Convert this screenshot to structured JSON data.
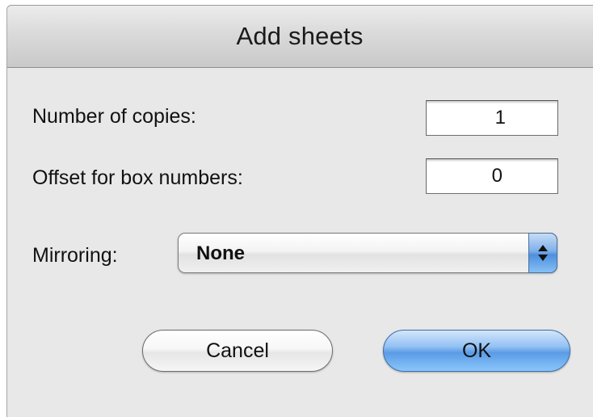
{
  "dialog": {
    "title": "Add sheets"
  },
  "fields": {
    "copies_label": "Number of copies:",
    "copies_value": "1",
    "offset_label": "Offset for box numbers:",
    "offset_value": "0"
  },
  "mirroring": {
    "label": "Mirroring:",
    "selected": "None"
  },
  "buttons": {
    "cancel": "Cancel",
    "ok": "OK"
  },
  "colors": {
    "default_button": "#5b9be6",
    "window_background": "#e8e8e8"
  },
  "icons": {
    "popup": "updown-arrows-icon"
  }
}
